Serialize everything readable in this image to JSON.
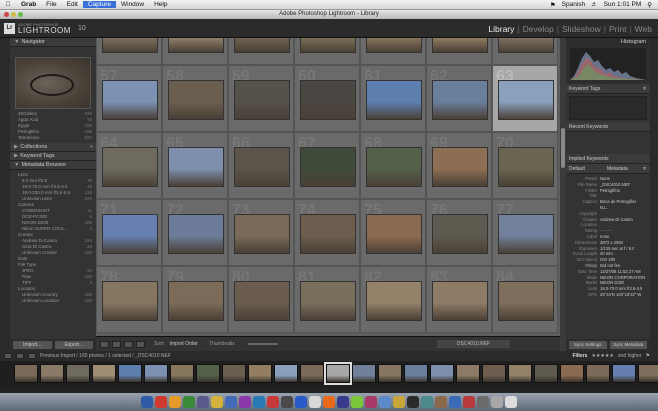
{
  "menubar": {
    "items": [
      "Grab",
      "File",
      "Edit",
      "Capture",
      "Window",
      "Help"
    ],
    "bold_item": "Grab",
    "highlighted": "Capture",
    "right": {
      "lang": "Spanish",
      "clock": "Sun 1:01 PM"
    }
  },
  "window": {
    "title": "Adobe Photoshop Lightroom - Library"
  },
  "header": {
    "logo_badge": "Lr",
    "logo_small": "ADOBE PHOTOSHOP",
    "logo_big": "LIGHTROOM",
    "version": "10",
    "modules": [
      "Library",
      "Develop",
      "Slideshow",
      "Print",
      "Web"
    ],
    "active_module": "Library"
  },
  "left_panel": {
    "navigator_label": "Navigator",
    "folders": [
      {
        "name": "45Gallery",
        "count": "220"
      },
      {
        "name": "Agua Azul",
        "count": "78"
      },
      {
        "name": "Egypt",
        "count": "100"
      },
      {
        "name": "Petroglifos",
        "count": "165"
      },
      {
        "name": "Tamarindo",
        "count": "220"
      }
    ],
    "collections_label": "Collections",
    "keyword_tags_label": "Keyword Tags",
    "metadata_browser_label": "Metadata Browser",
    "metadata": [
      {
        "name": "Lens",
        "count": "",
        "level": 0
      },
      {
        "name": "8.0 mm f/3.5",
        "count": "78",
        "level": 1
      },
      {
        "name": "18.0-70.0 mm f/3.5-4.5",
        "count": "42",
        "level": 1
      },
      {
        "name": "18.0-200.0 mm f/3.5-5.6",
        "count": "118",
        "level": 1
      },
      {
        "name": "Unknown Lens",
        "count": "100",
        "level": 1
      },
      {
        "name": "Camera",
        "count": "",
        "level": 0
      },
      {
        "name": "CYBERSHOT",
        "count": "11",
        "level": 1
      },
      {
        "name": "DCR-PC330",
        "count": "6",
        "level": 1
      },
      {
        "name": "NIKON D200",
        "count": "165",
        "level": 1
      },
      {
        "name": "Nikon SUPER COOL...",
        "count": "4",
        "level": 1
      },
      {
        "name": "Creator",
        "count": "",
        "level": 0
      },
      {
        "name": "Andrew Di Castro",
        "count": "165",
        "level": 1
      },
      {
        "name": "Gina Di Castro",
        "count": "34",
        "level": 1
      },
      {
        "name": "Unknown Creator",
        "count": "166",
        "level": 1
      },
      {
        "name": "Date",
        "count": "",
        "level": 0
      },
      {
        "name": "File Type",
        "count": "",
        "level": 0
      },
      {
        "name": "JPEG",
        "count": "40",
        "level": 1
      },
      {
        "name": "Raw",
        "count": "165",
        "level": 1
      },
      {
        "name": "TIFF",
        "count": "2",
        "level": 1
      },
      {
        "name": "Location",
        "count": "",
        "level": 0
      },
      {
        "name": "Unknown Country",
        "count": "165",
        "level": 1
      },
      {
        "name": "Unknown Location",
        "count": "165",
        "level": 1
      }
    ],
    "import_label": "Import...",
    "export_label": "Export..."
  },
  "grid": {
    "selected_index": 13,
    "numbers": [
      "",
      "",
      "",
      "",
      "",
      "",
      "",
      "57",
      "58",
      "59",
      "60",
      "61",
      "62",
      "63",
      "64",
      "65",
      "66",
      "67",
      "68",
      "69",
      "70",
      "71",
      "72",
      "73",
      "74",
      "75",
      "76",
      "77",
      "78",
      "79",
      "80",
      "81",
      "82",
      "83",
      "84"
    ],
    "thumb_colors": [
      [
        "#8a7a68",
        "#9e8c74",
        "#7a6a58",
        "#86765e",
        "#947e62",
        "#a08a6c",
        "#8a7c6a"
      ],
      [
        "#7d91b3",
        "#6a5e50",
        "#55514b",
        "#4a4642",
        "#5d7fb0",
        "#6a7f9d",
        "#8aa0bd"
      ],
      [
        "#6e6a5e",
        "#7e8fae",
        "#5c544a",
        "#3f4a3a",
        "#54614a",
        "#8c6e52",
        "#6a6652"
      ],
      [
        "#667fb0",
        "#6b7b98",
        "#7a6a58",
        "#6c5d4e",
        "#8b6a52",
        "#5e5a4f",
        "#72809c"
      ],
      [
        "#867560",
        "#7c6b58",
        "#6a5c4e",
        "#7a6e5d",
        "#938169",
        "#8e7b66",
        "#7f6e5c"
      ]
    ]
  },
  "toolbar": {
    "sort_label": "Sort:",
    "sort_value": "Import Order",
    "thumbnails_label": "Thumbnails",
    "filename": "DSC4010.NEF"
  },
  "right_panel": {
    "histogram_label": "Histogram",
    "keyword_tags_label": "Keyword Tags",
    "recent_keywords_label": "Recent Keywords",
    "implied_keywords_label": "Implied Keywords",
    "metadata_label": "Metadata",
    "default_label": "Default",
    "metadata_rows": [
      {
        "k": "Preset",
        "v": "None"
      },
      {
        "k": "File Name",
        "v": "_DSC4010.NEF"
      },
      {
        "k": "Folder",
        "v": "Petroglifos"
      },
      {
        "k": "Title",
        "v": ""
      },
      {
        "k": "Caption",
        "v": "Boca de Petroglifos"
      },
      {
        "k": "",
        "v": "N.L."
      },
      {
        "k": "Copyright",
        "v": ""
      },
      {
        "k": "Creator",
        "v": "Andrew Di Castro"
      },
      {
        "k": "Location",
        "v": ""
      },
      {
        "k": "Rating",
        "v": "- - - - -"
      },
      {
        "k": "Label",
        "v": "none"
      },
      {
        "k": "Dimensions",
        "v": "3872 x 2592"
      },
      {
        "k": "Exposure",
        "v": "1/125 sec at f / 9.0"
      },
      {
        "k": "Focal Length",
        "v": "40 mm"
      },
      {
        "k": "ISO Speed Rating",
        "v": "ISO 200"
      },
      {
        "k": "Flash",
        "v": "Did not fire"
      },
      {
        "k": "Date Time",
        "v": "12/27/06 11:52:27 AM"
      },
      {
        "k": "Make",
        "v": "NIKON CORPORATION"
      },
      {
        "k": "Model",
        "v": "NIKON D200"
      },
      {
        "k": "Lens",
        "v": "18.0-70.0 mm f/3.5-4.5"
      },
      {
        "k": "GPS",
        "v": "25°44'N 100°18'22\" W"
      }
    ],
    "sync_settings_label": "Sync Settings",
    "sync_metadata_label": "Sync Metadata"
  },
  "filmbar": {
    "status": "Previous Import / 165 photos / 1 selected / _DSC4010.NEF",
    "filters_label": "Filters",
    "filter_suffix": "and higher"
  },
  "filmstrip": {
    "selected_index": 12,
    "colors": [
      "#7a6a58",
      "#8a7a68",
      "#6e6a5e",
      "#9e8c74",
      "#5d7fb0",
      "#7d91b3",
      "#86765e",
      "#54614a",
      "#6a5e50",
      "#947e62",
      "#8aa0bd",
      "#7a6a58",
      "#a7a7a7",
      "#72809c",
      "#867560",
      "#6a7f9d",
      "#7e8fae",
      "#8e7b66",
      "#6c5d4e",
      "#938169",
      "#5e5a4f",
      "#8b6a52",
      "#7c6b58",
      "#667fb0",
      "#7f6e5c",
      "#6a6652"
    ]
  },
  "dock": {
    "colors": [
      "#2f5aa8",
      "#cf3a2e",
      "#e59a2b",
      "#3a8a3a",
      "#5a5a8a",
      "#d2b13c",
      "#456ab8",
      "#8a3aa8",
      "#2a7ab8",
      "#c83a3a",
      "#4a4a4a",
      "#2a5ac8",
      "#d8d8d8",
      "#e86a1a",
      "#3a3a8a",
      "#7ac83a",
      "#a83a6a",
      "#5a8ac8",
      "#c8a83a",
      "#2a2a2a",
      "#4a8a8a",
      "#8a6a4a",
      "#3a6ab8",
      "#b83a3a",
      "#6a6a6a",
      "#a8a8a8",
      "#dcdcdc"
    ]
  }
}
